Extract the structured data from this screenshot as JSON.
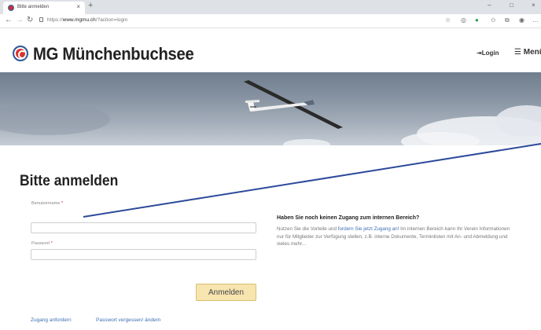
{
  "browser": {
    "tab_title": "Bitte anmelden",
    "tab_close": "×",
    "new_tab": "+",
    "url_prefix": "https://",
    "url_domain": "www.mgmu.ch",
    "url_path": "/?action=login",
    "window_controls": [
      "–",
      "□",
      "×"
    ]
  },
  "header": {
    "site_title": "MG Münchenbuchsee",
    "login_label": "Login",
    "menu_label": "Menü"
  },
  "main": {
    "page_title": "Bitte anmelden",
    "username_label": "Benutzername",
    "password_label": "Passwort",
    "required_mark": "*",
    "username_value": "",
    "password_value": "",
    "submit_label": "Anmelden",
    "links": [
      "Zugang anfordern",
      "Passwort vergessen/ ändern"
    ]
  },
  "info": {
    "heading": "Haben Sie noch keinen Zugang zum internen Bereich?",
    "text_before": "Nutzen Sie die Vorteile und ",
    "link": "fordern Sie jetzt Zugang an!",
    "text_after": " Im internen Bereich kann Ihr Verein Informationen nur für Mitglieder zur Verfügung stellen, z.B. interne Dokumente, Terminlisten mit An- und Abmeldung und vieles mehr..."
  },
  "colors": {
    "accent_button": "#f7e5b0",
    "link": "#3d6fb4",
    "logo_red": "#d9342b",
    "annotation_line": "#2c4a9a"
  }
}
